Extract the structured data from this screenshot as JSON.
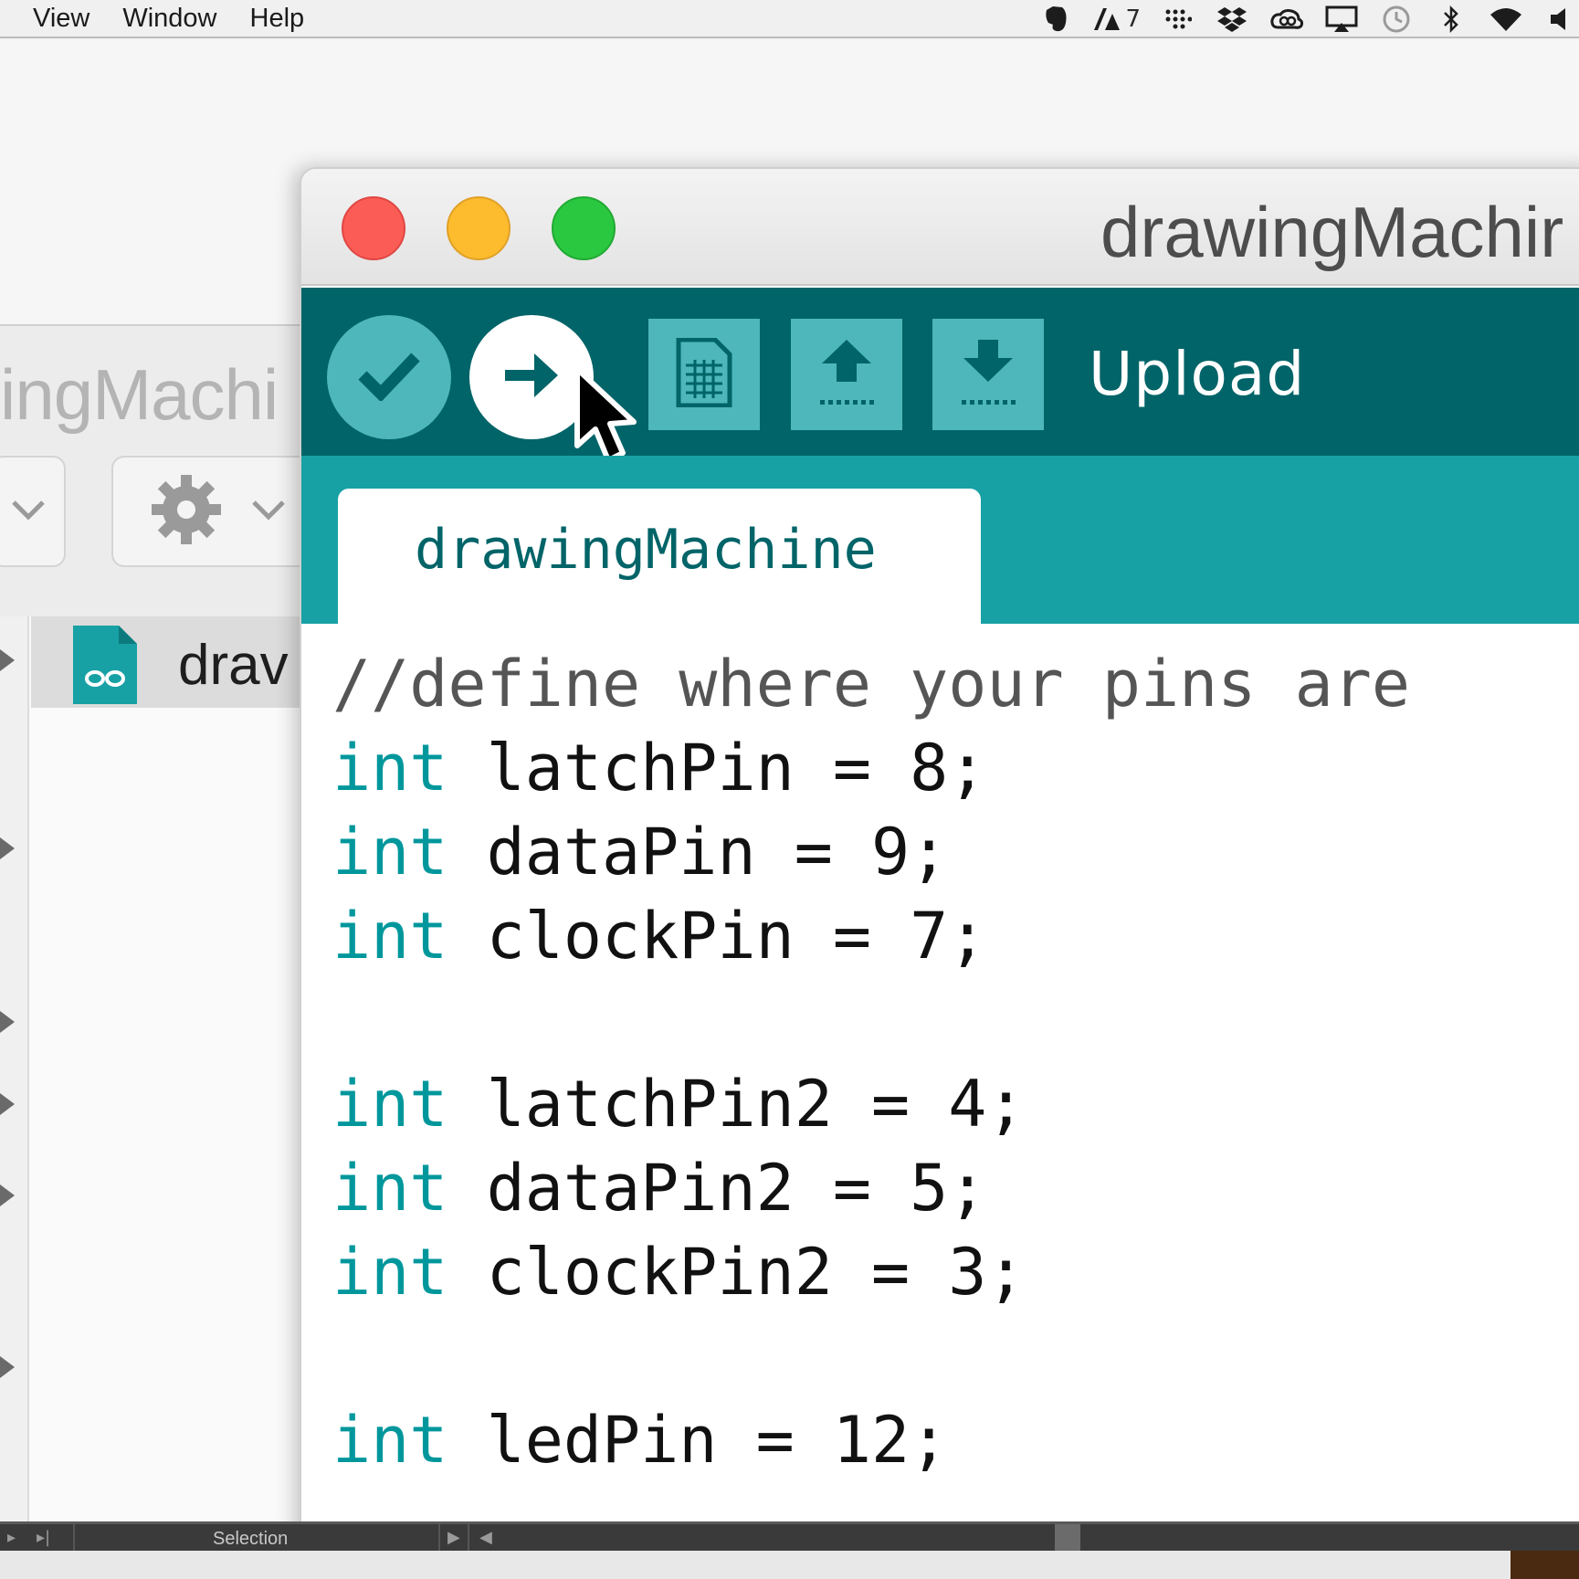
{
  "menubar": {
    "items": [
      "View",
      "Window",
      "Help"
    ],
    "status": {
      "evernote_icon": "elephant-icon",
      "adobe_count": "7",
      "icons": [
        "evernote-icon",
        "adobe-icon",
        "grid-dots-icon",
        "dropbox-icon",
        "creative-cloud-icon",
        "airplay-icon",
        "time-machine-icon",
        "bluetooth-icon",
        "wifi-icon",
        "volume-icon"
      ]
    }
  },
  "background_window": {
    "title_fragment": "ingMachi",
    "file_name_fragment": "drav"
  },
  "ide": {
    "title": "drawingMachir",
    "toolbar": {
      "hover_label": "Upload",
      "buttons": [
        "verify-button",
        "upload-button",
        "new-button",
        "open-button",
        "save-button"
      ]
    },
    "tab_label": "drawingMachine",
    "code": [
      {
        "type": "comment",
        "text": "//define where your pins are"
      },
      {
        "type": "decl",
        "kw": "int",
        "rest": " latchPin = 8;"
      },
      {
        "type": "decl",
        "kw": "int",
        "rest": " dataPin = 9;"
      },
      {
        "type": "decl",
        "kw": "int",
        "rest": " clockPin = 7;"
      },
      {
        "type": "blank"
      },
      {
        "type": "decl",
        "kw": "int",
        "rest": " latchPin2 = 4;"
      },
      {
        "type": "decl",
        "kw": "int",
        "rest": " dataPin2 = 5;"
      },
      {
        "type": "decl",
        "kw": "int",
        "rest": " clockPin2 = 3;"
      },
      {
        "type": "blank"
      },
      {
        "type": "decl",
        "kw": "int",
        "rest": " ledPin = 12;"
      }
    ],
    "colors": {
      "toolbar": "#006468",
      "tabbar": "#17a1a5",
      "button": "#4db7bb",
      "keyword": "#00979c"
    }
  },
  "bottom_bar": {
    "selection_label": "Selection"
  }
}
